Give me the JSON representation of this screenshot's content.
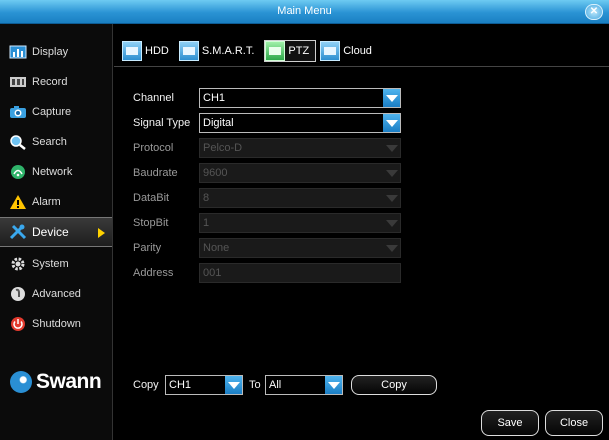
{
  "window": {
    "title": "Main Menu"
  },
  "sidebar": {
    "items": [
      {
        "label": "Display",
        "icon": "display-icon",
        "active": false
      },
      {
        "label": "Record",
        "icon": "record-icon",
        "active": false
      },
      {
        "label": "Capture",
        "icon": "capture-icon",
        "active": false
      },
      {
        "label": "Search",
        "icon": "search-icon",
        "active": false
      },
      {
        "label": "Network",
        "icon": "network-icon",
        "active": false
      },
      {
        "label": "Alarm",
        "icon": "alarm-icon",
        "active": false
      },
      {
        "label": "Device",
        "icon": "device-icon",
        "active": true
      },
      {
        "label": "System",
        "icon": "system-icon",
        "active": false
      },
      {
        "label": "Advanced",
        "icon": "advanced-icon",
        "active": false
      },
      {
        "label": "Shutdown",
        "icon": "shutdown-icon",
        "active": false
      }
    ],
    "brand": "Swann"
  },
  "tabs": [
    {
      "label": "HDD",
      "active": false
    },
    {
      "label": "S.M.A.R.T.",
      "active": false
    },
    {
      "label": "PTZ",
      "active": true
    },
    {
      "label": "Cloud",
      "active": false
    }
  ],
  "form": {
    "channel": {
      "label": "Channel",
      "value": "CH1"
    },
    "signal_type": {
      "label": "Signal Type",
      "value": "Digital"
    },
    "protocol": {
      "label": "Protocol",
      "value": "Pelco-D"
    },
    "baudrate": {
      "label": "Baudrate",
      "value": "9600"
    },
    "databit": {
      "label": "DataBit",
      "value": "8"
    },
    "stopbit": {
      "label": "StopBit",
      "value": "1"
    },
    "parity": {
      "label": "Parity",
      "value": "None"
    },
    "address": {
      "label": "Address",
      "value": "001"
    }
  },
  "copy": {
    "label": "Copy",
    "from_value": "CH1",
    "to_label": "To",
    "to_value": "All",
    "button": "Copy"
  },
  "footer": {
    "save": "Save",
    "close": "Close"
  },
  "colors": {
    "accent": "#2a93d4",
    "active_tab": "#2ea84a",
    "arrow": "#ffd200"
  }
}
